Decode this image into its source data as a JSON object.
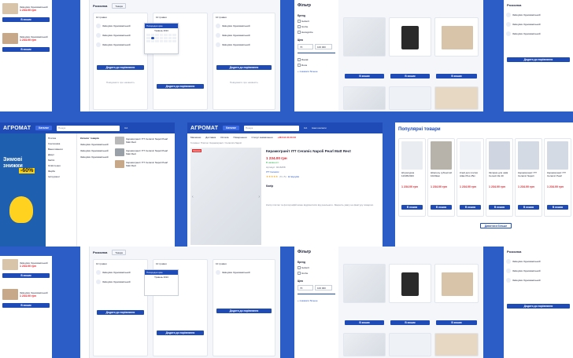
{
  "colors": {
    "accent": "#1e4bb5",
    "background": "#2c5cc5",
    "sale": "#e02b2b",
    "stock": "#2eae4c"
  },
  "brand": {
    "logo": "АГРОМАТ"
  },
  "header": {
    "catalog": "Каталог",
    "search_placeholder": "Пошук",
    "ua": "UA",
    "phone_hint": "Наші контакти",
    "phone": "+38 044 33 33 33"
  },
  "toolbar_items": [
    "Магазини",
    "Доставка",
    "Оплата",
    "Повернення",
    "Статус замовлення",
    "Поради"
  ],
  "breadcrumb": "Головна / Плитка / Керамограніт / Ceramics Napoli",
  "product": {
    "title": "Керамограніт ITT Ceramic Napoli Pearl Matt Rect",
    "price": "1 234.00 грн",
    "old_price": "1 500.00 грн",
    "in_stock": "В наявності",
    "code_label": "Артикул: 9216458",
    "rating_count": "(5 з 5)",
    "reviews": "12 відгуків",
    "brand_label": "ITT Ceramic",
    "action_label": "В кошик",
    "section": "Колір",
    "description": "Колір плитки та фотографій може відрізнятися від реального. Зверніть увагу на фактуру поверхні."
  },
  "dropdown": {
    "title": "Розсилка",
    "tab": "Товари",
    "item": "10 травня",
    "calendar_title": "Травень 2024",
    "option": "Попередня ціна"
  },
  "filter": {
    "title": "Фільтр",
    "section_brand": "Бренд",
    "section_price": "Ціна",
    "price_from": "70",
    "price_to": "100 000",
    "show_more": "+ показати більше",
    "brands": [
      "Geberit",
      "Grohe",
      "Hansgrohe",
      "Ravak",
      "Roca"
    ]
  },
  "sidebar_menu": [
    "Плитка",
    "Сантехніка",
    "Ванні кімнати",
    "Двері",
    "Меблі",
    "Освітлення",
    "Фарби",
    "Інструмент"
  ],
  "sidebar_menu_header": "Каталог товарів",
  "promo": {
    "line1": "Зимові",
    "line2": "знижки",
    "percent": "-60%"
  },
  "list_items": [
    {
      "name": "Змішувач Одноважільний",
      "price": "1 234.00 грн"
    },
    {
      "name": "Змішувач Одноважільний",
      "price": "1 234.00 грн"
    },
    {
      "name": "Змішувач Одноважільний",
      "price": "1 234.00 грн"
    }
  ],
  "tile_cards": [
    {
      "name": "Керамограніт ITT Ceramic Napoli Pearl Matt Rect",
      "price": "1 234.00 грн",
      "badge": "Знижка"
    },
    {
      "name": "Керамограніт ITT Ceramic Napoli Pearl Matt Rect",
      "price": "1 234.00 грн",
      "badge": "Новинка"
    },
    {
      "name": "Керамограніт ITT Ceramic Napoli Pearl Matt Rect",
      "price": "1 234.00 грн",
      "badge": "Знижка"
    }
  ],
  "popular": {
    "heading": "Популярні товари",
    "more": "Дивитися більше",
    "cards": [
      {
        "name": "Штукатурка 12345/2023",
        "price": "1 234.00 грн"
      },
      {
        "name": "Шпатель зубчастий 10/20мм",
        "price": "1 234.00 грн"
      },
      {
        "name": "Клей для плитки Atlas Plus 25кг",
        "price": "1 234.00 грн"
      },
      {
        "name": "Затирка для швів Ceresit CE 40",
        "price": "1 234.00 грн"
      },
      {
        "name": "Керамограніт ITT Ceramic Napoli",
        "price": "1 234.00 грн"
      },
      {
        "name": "Керамограніт ITT Ceramic Pearl",
        "price": "1 234.00 грн"
      }
    ]
  },
  "buy_label": "В кошик",
  "pickup_label": "Додати до порівняння",
  "notify_label": "Повідомити про наявність"
}
